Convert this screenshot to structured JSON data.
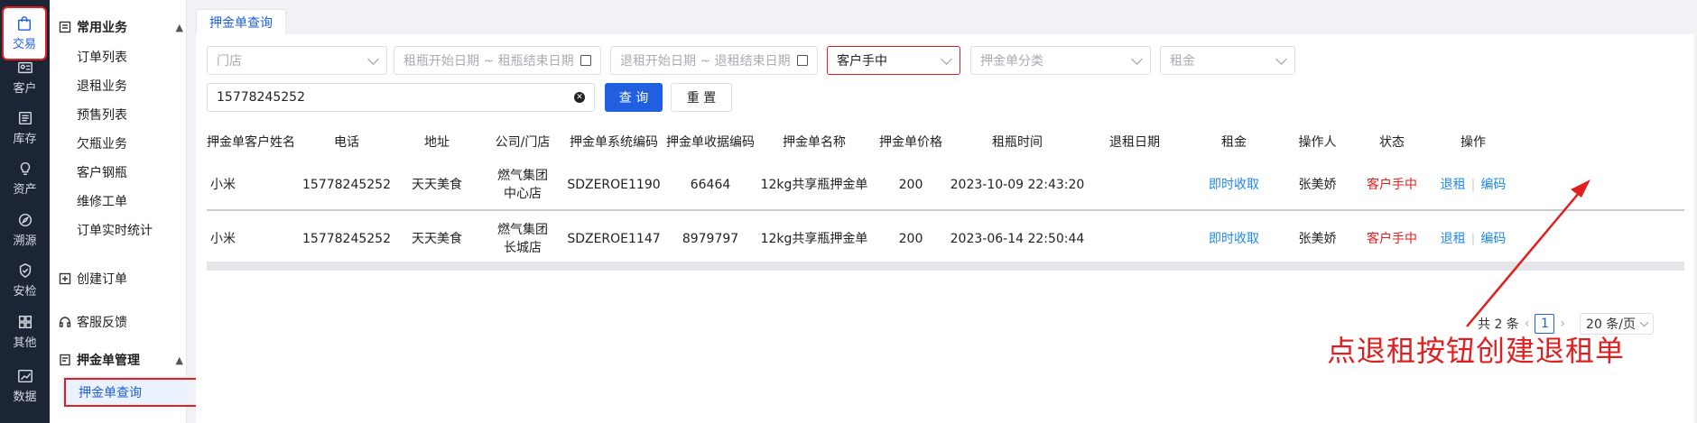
{
  "rail": {
    "items": [
      {
        "label": "交易",
        "icon": "bag-icon",
        "active": true
      },
      {
        "label": "客户",
        "icon": "id-card-icon"
      },
      {
        "label": "库存",
        "icon": "list-doc-icon"
      },
      {
        "label": "资产",
        "icon": "bulb-icon"
      },
      {
        "label": "溯源",
        "icon": "compass-icon"
      },
      {
        "label": "安检",
        "icon": "shield-check-icon"
      },
      {
        "label": "其他",
        "icon": "grid-icon"
      },
      {
        "label": "数据",
        "icon": "chart-icon"
      }
    ]
  },
  "menu": {
    "group1": {
      "title": "常用业务",
      "items": [
        "订单列表",
        "退租业务",
        "预售列表",
        "欠瓶业务",
        "客户钢瓶",
        "维修工单",
        "订单实时统计"
      ]
    },
    "create_order": "创建订单",
    "feedback": "客服反馈",
    "group2": {
      "title": "押金单管理",
      "active_item": "押金单查询"
    }
  },
  "tab": {
    "label": "押金单查询"
  },
  "filters": {
    "store_placeholder": "门店",
    "rent_date_placeholder": "租瓶开始日期 ~ 租瓶结束日期",
    "return_date_placeholder": "退租开始日期 ~ 退租结束日期",
    "status_value": "客户手中",
    "category_placeholder": "押金单分类",
    "deposit_placeholder": "租金",
    "phone_value": "15778245252",
    "search_button": "查 询",
    "reset_button": "重 置"
  },
  "table": {
    "headers": [
      "押金单客户姓名",
      "电话",
      "地址",
      "公司/门店",
      "押金单系统编码",
      "押金单收据编码",
      "押金单名称",
      "押金单价格",
      "租瓶时间",
      "退租日期",
      "租金",
      "操作人",
      "状态",
      "操作"
    ],
    "rows": [
      {
        "name": "小米",
        "phone": "15778245252",
        "address": "天天美食",
        "company_line1": "燃气集团",
        "company_line2": "中心店",
        "system_code": "SDZEROE1190",
        "receipt_code": "66464",
        "title": "12kg共享瓶押金单",
        "price": "200",
        "rent_time": "2023-10-09 22:43:20",
        "return_date": "",
        "rent": "即时收取",
        "operator": "张美娇",
        "status": "客户手中",
        "op_return": "退租",
        "op_code": "编码"
      },
      {
        "name": "小米",
        "phone": "15778245252",
        "address": "天天美食",
        "company_line1": "燃气集团",
        "company_line2": "长城店",
        "system_code": "SDZEROE1147",
        "receipt_code": "8979797",
        "title": "12kg共享瓶押金单",
        "price": "200",
        "rent_time": "2023-06-14 22:50:44",
        "return_date": "",
        "rent": "即时收取",
        "operator": "张美娇",
        "status": "客户手中",
        "op_return": "退租",
        "op_code": "编码"
      }
    ]
  },
  "pager": {
    "total": "共 2 条",
    "page": "1",
    "page_size": "20 条/页"
  },
  "annotation": {
    "text": "点退租按钮创建退租单",
    "color": "#e02020"
  }
}
